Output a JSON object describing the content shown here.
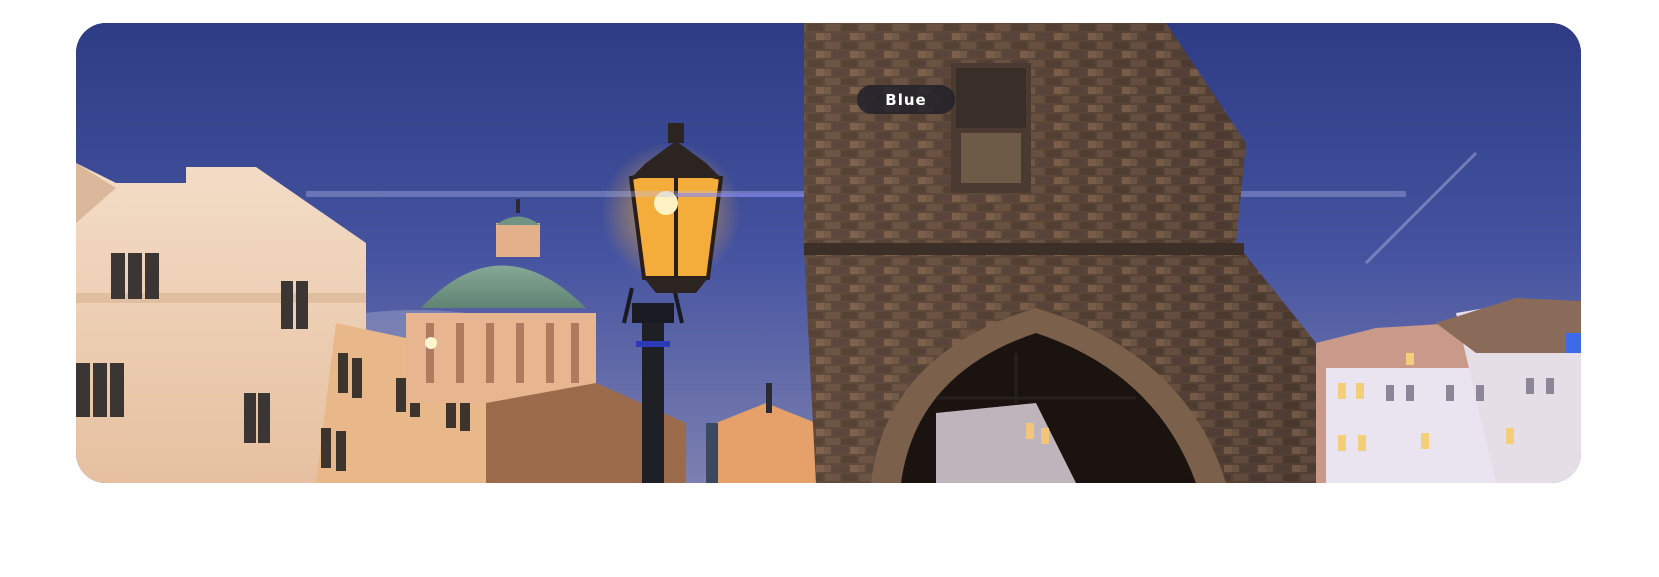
{
  "image_label": "Blue",
  "colors": {
    "sky": "#3b4a93",
    "lamp_glow": "#f7b23a",
    "tower_stone": "#5a4538",
    "building_cream": "#efd3b8"
  },
  "scene": {
    "icon": "photo-scene"
  }
}
